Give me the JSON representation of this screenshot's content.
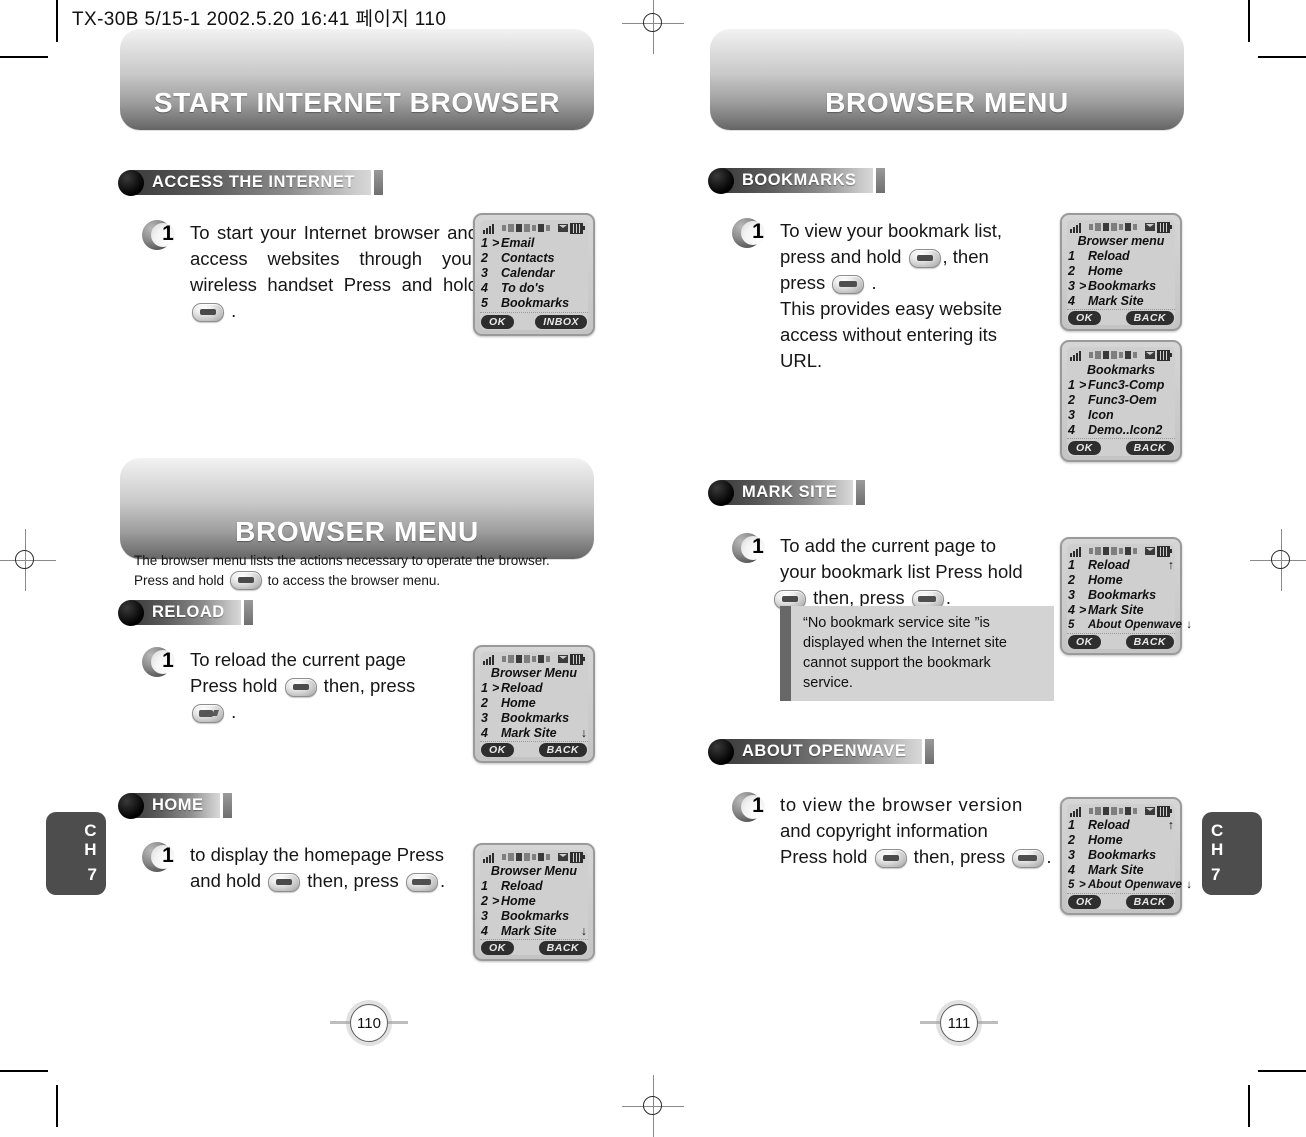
{
  "print": {
    "file_tag": "TX-30B 5/15-1  2002.5.20 16:41  페이지 110"
  },
  "left_page": {
    "number": "110",
    "chapter_tab": {
      "line1": "C",
      "line2": "H",
      "line3": "7"
    },
    "chapter_header": "START INTERNET BROWSER",
    "sections": [
      {
        "title": "ACCESS THE INTERNET",
        "step_number": "1",
        "text_runs": [
          "To start your Internet browser and access websites through your wireless handset Press and hold ",
          " ."
        ],
        "screen": {
          "title": "",
          "rows": [
            {
              "idx": "1",
              "mark": ">",
              "label": "Email",
              "arrow": ""
            },
            {
              "idx": "2",
              "mark": "",
              "label": "Contacts",
              "arrow": ""
            },
            {
              "idx": "3",
              "mark": "",
              "label": "Calendar",
              "arrow": ""
            },
            {
              "idx": "4",
              "mark": "",
              "label": "To do's",
              "arrow": ""
            },
            {
              "idx": "5",
              "mark": "",
              "label": "Bookmarks",
              "arrow": ""
            }
          ],
          "softkey_left": "OK",
          "softkey_right": "INBOX"
        }
      }
    ],
    "chapter_header2": "BROWSER MENU",
    "intro_line1": "The browser menu lists the actions necessary to operate the browser.",
    "intro_line2_a": "Press and hold ",
    "intro_line2_b": " to access the browser menu.",
    "sections2": [
      {
        "title": "RELOAD",
        "step_number": "1",
        "line1": "To reload the current page",
        "line2_a": "Press hold ",
        "line2_b": " then, press",
        "line3": " .",
        "screen": {
          "title": "Browser Menu",
          "rows": [
            {
              "idx": "1",
              "mark": ">",
              "label": "Reload",
              "arrow": ""
            },
            {
              "idx": "2",
              "mark": "",
              "label": "Home",
              "arrow": ""
            },
            {
              "idx": "3",
              "mark": "",
              "label": "Bookmarks",
              "arrow": ""
            },
            {
              "idx": "4",
              "mark": "",
              "label": "Mark Site",
              "arrow": "↓"
            }
          ],
          "softkey_left": "OK",
          "softkey_right": "BACK"
        }
      },
      {
        "title": "HOME",
        "step_number": "1",
        "line1": "to display the homepage Press",
        "line2_a": "and hold ",
        "line2_b": " then,  press ",
        "line2_c": ".",
        "screen": {
          "title": "Browser Menu",
          "rows": [
            {
              "idx": "1",
              "mark": "",
              "label": "Reload",
              "arrow": ""
            },
            {
              "idx": "2",
              "mark": ">",
              "label": "Home",
              "arrow": ""
            },
            {
              "idx": "3",
              "mark": "",
              "label": "Bookmarks",
              "arrow": ""
            },
            {
              "idx": "4",
              "mark": "",
              "label": "Mark Site",
              "arrow": "↓"
            }
          ],
          "softkey_left": "OK",
          "softkey_right": "BACK"
        }
      }
    ]
  },
  "right_page": {
    "number": "111",
    "chapter_tab": {
      "line1": "C",
      "line2": "H",
      "line3": "7"
    },
    "chapter_header": "BROWSER MENU",
    "sections": [
      {
        "title": "BOOKMARKS",
        "step_number": "1",
        "line1": "To view your bookmark list,",
        "line2_a": "press and hold ",
        "line2_b": ", then",
        "line3_a": "press ",
        "line3_b": " .",
        "line4": "This provides easy website",
        "line5": "access without entering its",
        "line6": "URL.",
        "screen1": {
          "title": "Browser menu",
          "rows": [
            {
              "idx": "1",
              "mark": "",
              "label": "Reload",
              "arrow": ""
            },
            {
              "idx": "2",
              "mark": "",
              "label": "Home",
              "arrow": ""
            },
            {
              "idx": "3",
              "mark": ">",
              "label": "Bookmarks",
              "arrow": ""
            },
            {
              "idx": "4",
              "mark": "",
              "label": "Mark Site",
              "arrow": ""
            }
          ],
          "softkey_left": "OK",
          "softkey_right": "BACK"
        },
        "screen2": {
          "title": "Bookmarks",
          "rows": [
            {
              "idx": "1",
              "mark": ">",
              "label": "Func3-Comp",
              "arrow": ""
            },
            {
              "idx": "2",
              "mark": "",
              "label": "Func3-Oem",
              "arrow": ""
            },
            {
              "idx": "3",
              "mark": "",
              "label": "Icon",
              "arrow": ""
            },
            {
              "idx": "4",
              "mark": "",
              "label": "Demo..Icon2",
              "arrow": ""
            }
          ],
          "softkey_left": "OK",
          "softkey_right": "BACK"
        }
      },
      {
        "title": "MARK SITE",
        "step_number": "1",
        "line1": "To add the current page to",
        "line2": "your bookmark list Press  hold",
        "line3_a": " then, press ",
        "line3_b": ".",
        "note": "“No bookmark service site ”is displayed when the Internet site cannot support the bookmark service.",
        "screen": {
          "title": "",
          "rows": [
            {
              "idx": "1",
              "mark": "",
              "label": "Reload",
              "arrow": "↑"
            },
            {
              "idx": "2",
              "mark": "",
              "label": "Home",
              "arrow": ""
            },
            {
              "idx": "3",
              "mark": "",
              "label": "Bookmarks",
              "arrow": ""
            },
            {
              "idx": "4",
              "mark": ">",
              "label": "Mark Site",
              "arrow": ""
            },
            {
              "idx": "5",
              "mark": "",
              "label": "About Openwave",
              "arrow": "↓"
            }
          ],
          "softkey_left": "OK",
          "softkey_right": "BACK"
        }
      },
      {
        "title": "ABOUT OPENWAVE",
        "step_number": "1",
        "line1": "to view the  browser version",
        "line2": "and copyright  information",
        "line3_a": "Press hold ",
        "line3_b": " then, press ",
        "line3_c": ".",
        "screen": {
          "title": "",
          "rows": [
            {
              "idx": "1",
              "mark": "",
              "label": "Reload",
              "arrow": "↑"
            },
            {
              "idx": "2",
              "mark": "",
              "label": "Home",
              "arrow": ""
            },
            {
              "idx": "3",
              "mark": "",
              "label": "Bookmarks",
              "arrow": ""
            },
            {
              "idx": "4",
              "mark": "",
              "label": "Mark Site",
              "arrow": ""
            },
            {
              "idx": "5",
              "mark": ">",
              "label": "About Openwave",
              "arrow": "↓"
            }
          ],
          "softkey_left": "OK",
          "softkey_right": "BACK"
        }
      }
    ]
  }
}
